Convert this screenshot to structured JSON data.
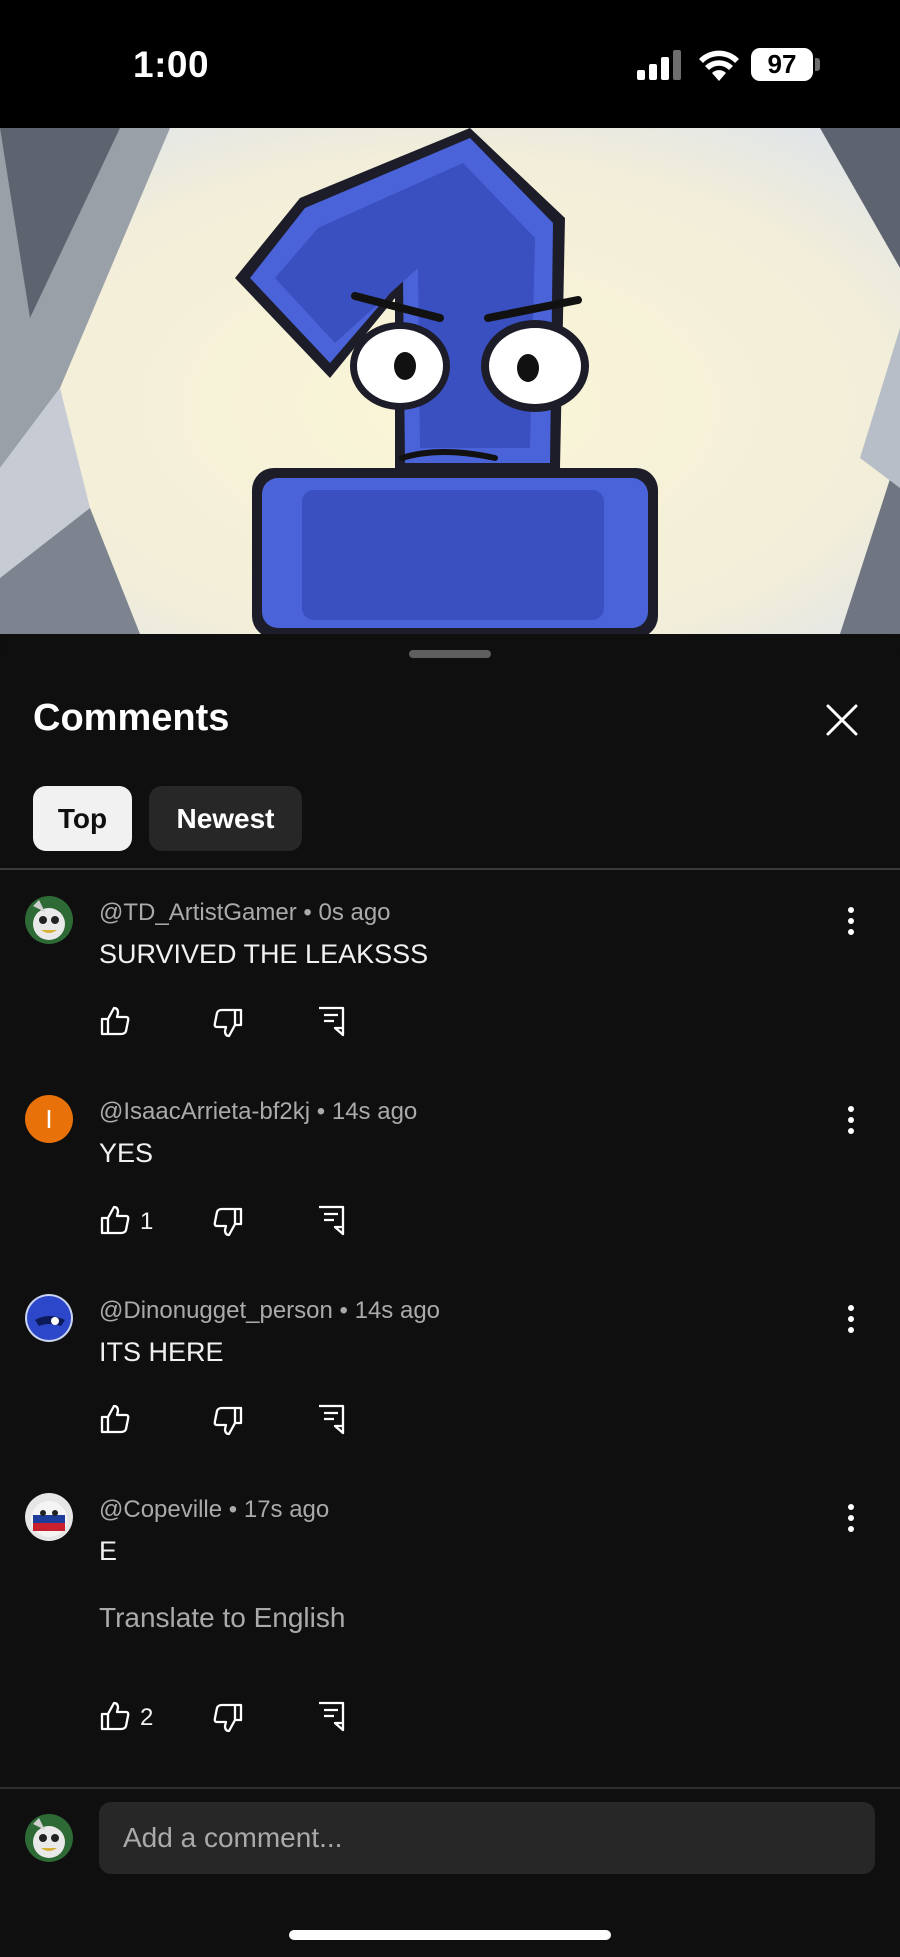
{
  "status_bar": {
    "time": "1:00",
    "battery": "97"
  },
  "comments_panel": {
    "title": "Comments",
    "sort_tabs": [
      {
        "label": "Top",
        "selected": true
      },
      {
        "label": "Newest",
        "selected": false
      }
    ],
    "comments": [
      {
        "author": "@TD_ArtistGamer",
        "time": "0s ago",
        "text": "SURVIVED THE LEAKSSS",
        "likes": "",
        "avatar_icon": "cartoon-avatar"
      },
      {
        "author": "@IsaacArrieta-bf2kj",
        "time": "14s ago",
        "text": "YES",
        "likes": "1",
        "avatar_letter": "I",
        "avatar_color": "#e8710a"
      },
      {
        "author": "@Dinonugget_person",
        "time": "14s ago",
        "text": "ITS HERE",
        "likes": "",
        "avatar_icon": "blue-ball-avatar"
      },
      {
        "author": "@Copeville",
        "time": "17s ago",
        "text": "E",
        "translate": "Translate to English",
        "likes": "2",
        "avatar_icon": "flag-ball-avatar"
      }
    ],
    "separator": "•",
    "add_comment_placeholder": "Add a comment..."
  },
  "colors": {
    "background": "#0f0f0f",
    "chip_selected": "#f1f1f1",
    "chip_unselected": "#272727",
    "secondary_text": "#aaaaaa",
    "character_blue": "#4a63d8"
  }
}
